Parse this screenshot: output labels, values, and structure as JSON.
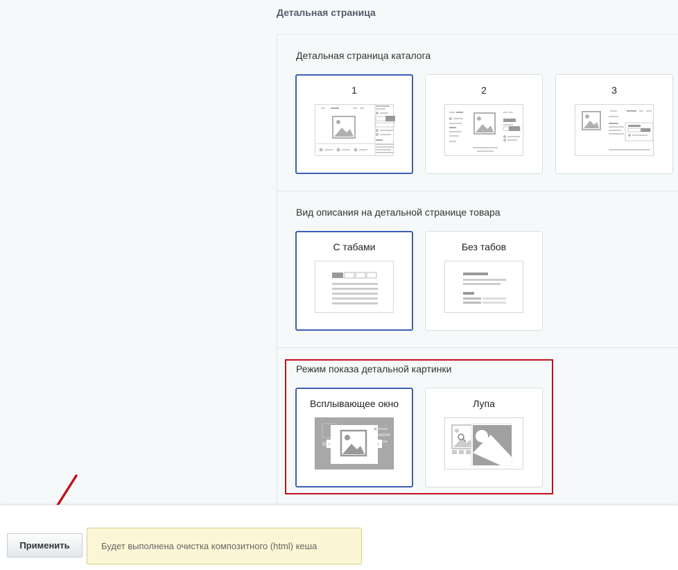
{
  "section": {
    "title": "Детальная страница"
  },
  "groups": [
    {
      "label": "Детальная страница каталога",
      "options": [
        {
          "label": "1",
          "selected": true
        },
        {
          "label": "2",
          "selected": false
        },
        {
          "label": "3",
          "selected": false
        }
      ]
    },
    {
      "label": "Вид описания на детальной странице товара",
      "options": [
        {
          "label": "С табами",
          "selected": true
        },
        {
          "label": "Без табов",
          "selected": false
        }
      ]
    },
    {
      "label": "Режим показа детальной картинки",
      "options": [
        {
          "label": "Всплывающее окно",
          "selected": true
        },
        {
          "label": "Лупа",
          "selected": false
        }
      ]
    }
  ],
  "footer": {
    "apply_label": "Применить",
    "notice": "Будет выполнена очистка композитного (html) кеша"
  },
  "colors": {
    "selected_border": "#3d5fb8",
    "highlight": "#c0121b",
    "arrow": "#c0121b"
  }
}
